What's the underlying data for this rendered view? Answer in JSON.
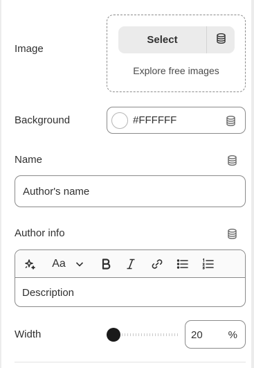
{
  "image": {
    "label": "Image",
    "select_label": "Select",
    "explore_label": "Explore free images"
  },
  "background": {
    "label": "Background",
    "value": "#FFFFFF"
  },
  "name": {
    "label": "Name",
    "value": "Author's name"
  },
  "author_info": {
    "label": "Author info",
    "toolbar": {
      "font_style_label": "Aa"
    },
    "value": "Description"
  },
  "width": {
    "label": "Width",
    "value": "20",
    "unit": "%",
    "slider_fraction": 0.0
  },
  "icons": {
    "dynamic_source": "database-icon",
    "ai": "sparkle-icon",
    "bold": "bold-icon",
    "italic": "italic-icon",
    "link": "link-icon",
    "bullet_list": "bullet-list-icon",
    "numbered_list": "numbered-list-icon",
    "chevron": "chevron-down-icon"
  },
  "colors": {
    "text": "#303030",
    "border": "#8a8a8a",
    "button_bg": "#ebebeb",
    "slider_thumb": "#1a1a1a"
  }
}
